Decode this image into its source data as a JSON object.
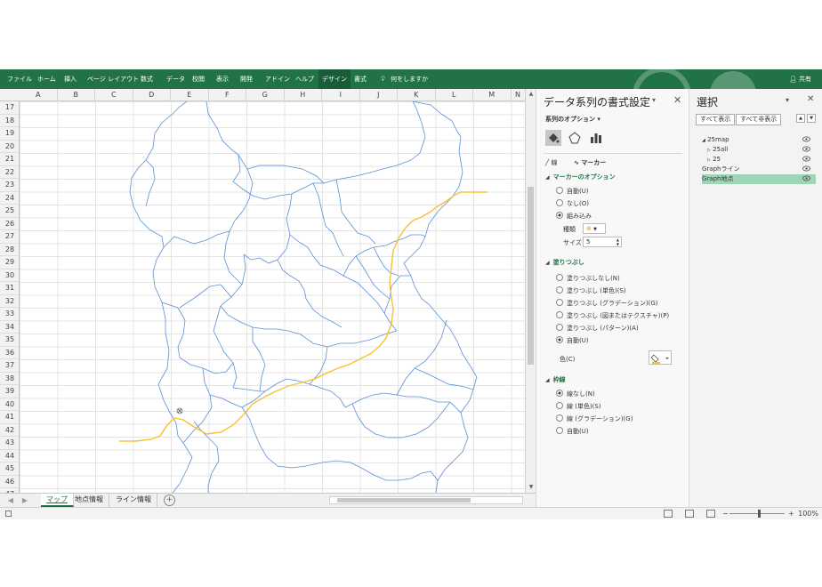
{
  "ribbon": {
    "tabs": [
      "ファイル",
      "ホーム",
      "挿入",
      "ページ レイアウト",
      "数式",
      "データ",
      "校閲",
      "表示",
      "開発",
      "アドイン",
      "ヘルプ",
      "デザイン",
      "書式"
    ],
    "tell_me": "何をしますか",
    "share": "共有"
  },
  "columns": [
    "A",
    "B",
    "C",
    "D",
    "E",
    "F",
    "G",
    "H",
    "I",
    "J",
    "K",
    "L",
    "M",
    "N"
  ],
  "rows": [
    "17",
    "18",
    "19",
    "20",
    "21",
    "22",
    "23",
    "24",
    "25",
    "26",
    "27",
    "28",
    "29",
    "30",
    "31",
    "32",
    "33",
    "34",
    "35",
    "36",
    "37",
    "38",
    "39",
    "40",
    "41",
    "42",
    "43",
    "44",
    "45",
    "46",
    "47"
  ],
  "sheets": [
    "マップ",
    "地点情報",
    "ライン情報"
  ],
  "format_pane": {
    "title": "データ系列の書式設定",
    "series_options": "系列のオプション",
    "subtab_line": "線",
    "subtab_marker": "マーカー",
    "marker_options": "マーカーのオプション",
    "marker_auto": "自動(U)",
    "marker_none": "なし(O)",
    "marker_builtin": "組み込み",
    "type_label": "種類",
    "size_label": "サイズ",
    "size_value": "5",
    "fill_title": "塗りつぶし",
    "fill_none": "塗りつぶしなし(N)",
    "fill_solid": "塗りつぶし (単色)(S)",
    "fill_gradient": "塗りつぶし (グラデーション)(G)",
    "fill_picture": "塗りつぶし (図またはテクスチャ)(P)",
    "fill_pattern": "塗りつぶし (パターン)(A)",
    "fill_auto": "自動(U)",
    "color_label": "色(C)",
    "border_title": "枠線",
    "border_none": "線なし(N)",
    "border_solid": "線 (単色)(S)",
    "border_gradient": "線 (グラデーション)(G)",
    "border_auto": "自動(U)"
  },
  "selection_pane": {
    "title": "選択",
    "show_all": "すべて表示",
    "hide_all": "すべて非表示",
    "items": [
      "25map",
      "25all",
      "25",
      "Graphライン",
      "Graph地点"
    ]
  },
  "status": {
    "zoom": "100%"
  },
  "colors": {
    "ribbon": "#217346",
    "route": "#f5c330",
    "boundary": "#5a8fd6",
    "selected": "#9fd5b7"
  }
}
